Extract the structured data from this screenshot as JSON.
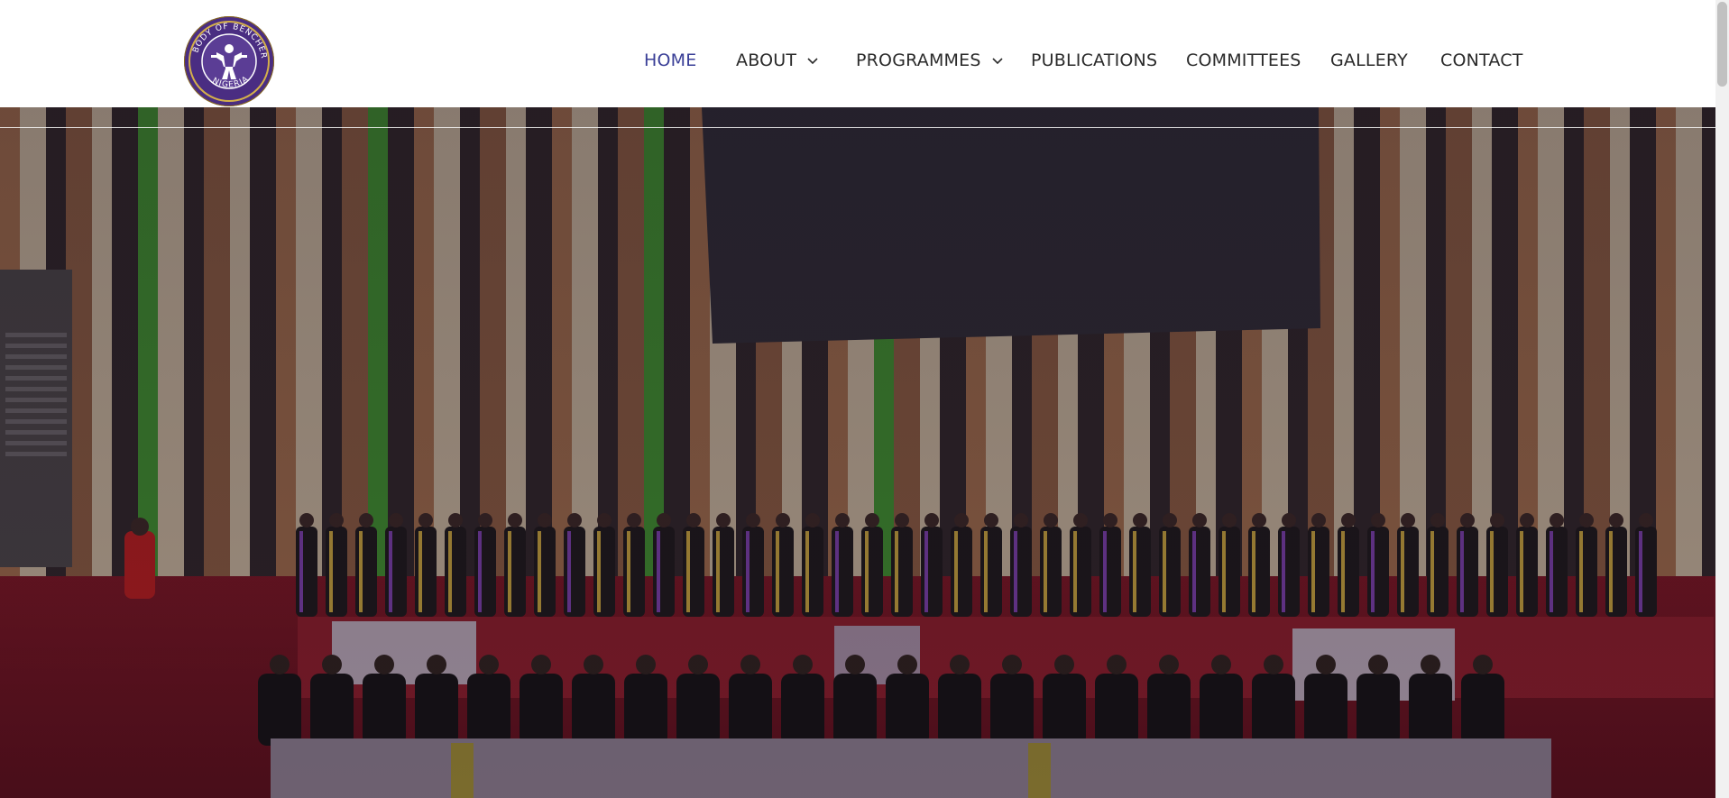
{
  "header": {
    "logo": {
      "icon": "body-of-benchers-seal",
      "lettering": "BODY OF BENCHERS · NIGERIA"
    },
    "nav": [
      {
        "label": "HOME",
        "active": true,
        "dropdown": false
      },
      {
        "label": "ABOUT",
        "active": false,
        "dropdown": true
      },
      {
        "label": "PROGRAMMES",
        "active": false,
        "dropdown": true
      },
      {
        "label": "PUBLICATIONS",
        "active": false,
        "dropdown": false
      },
      {
        "label": "COMMITTEES",
        "active": false,
        "dropdown": false
      },
      {
        "label": "GALLERY",
        "active": false,
        "dropdown": false
      },
      {
        "label": "CONTACT",
        "active": false,
        "dropdown": false
      }
    ]
  },
  "hero": {
    "image": "ceremony-hall-photo"
  },
  "colors": {
    "nav_active": "#3a3f97",
    "nav_text": "#2a2a2a",
    "logo_purple": "#4a2d82",
    "logo_gold": "#c9a63a"
  }
}
